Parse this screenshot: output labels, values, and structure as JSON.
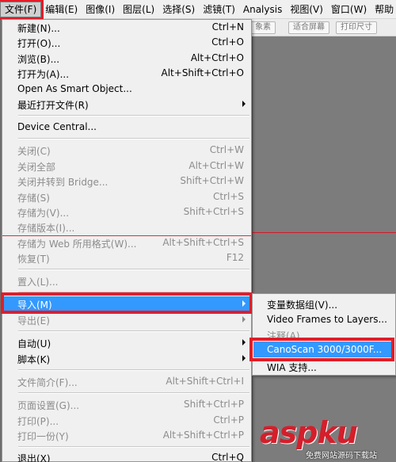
{
  "menubar": {
    "items": [
      "文件(F)",
      "编辑(E)",
      "图像(I)",
      "图层(L)",
      "选择(S)",
      "滤镜(T)",
      "Analysis",
      "视图(V)",
      "窗口(W)",
      "帮助"
    ]
  },
  "toolbar": {
    "buttons": [
      "象素",
      "适合屏幕",
      "打印尺寸"
    ]
  },
  "file_menu": {
    "items": [
      {
        "label": "新建(N)...",
        "shortcut": "Ctrl+N"
      },
      {
        "label": "打开(O)...",
        "shortcut": "Ctrl+O"
      },
      {
        "label": "浏览(B)...",
        "shortcut": "Alt+Ctrl+O"
      },
      {
        "label": "打开为(A)...",
        "shortcut": "Alt+Shift+Ctrl+O"
      },
      {
        "label": "Open As Smart Object...",
        "shortcut": ""
      },
      {
        "label": "最近打开文件(R)",
        "shortcut": ""
      },
      {
        "label": "Device Central...",
        "shortcut": ""
      },
      {
        "label": "关闭(C)",
        "shortcut": "Ctrl+W"
      },
      {
        "label": "关闭全部",
        "shortcut": "Alt+Ctrl+W"
      },
      {
        "label": "关闭并转到 Bridge...",
        "shortcut": "Shift+Ctrl+W"
      },
      {
        "label": "存储(S)",
        "shortcut": "Ctrl+S"
      },
      {
        "label": "存储为(V)...",
        "shortcut": "Shift+Ctrl+S"
      },
      {
        "label": "存储版本(I)...",
        "shortcut": ""
      },
      {
        "label": "存储为 Web 所用格式(W)...",
        "shortcut": "Alt+Shift+Ctrl+S"
      },
      {
        "label": "恢复(T)",
        "shortcut": "F12"
      },
      {
        "label": "置入(L)...",
        "shortcut": ""
      },
      {
        "label": "导入(M)",
        "shortcut": ""
      },
      {
        "label": "导出(E)",
        "shortcut": ""
      },
      {
        "label": "自动(U)",
        "shortcut": ""
      },
      {
        "label": "脚本(K)",
        "shortcut": ""
      },
      {
        "label": "文件简介(F)...",
        "shortcut": "Alt+Shift+Ctrl+I"
      },
      {
        "label": "页面设置(G)...",
        "shortcut": "Shift+Ctrl+P"
      },
      {
        "label": "打印(P)...",
        "shortcut": "Ctrl+P"
      },
      {
        "label": "打印一份(Y)",
        "shortcut": "Alt+Shift+Ctrl+P"
      },
      {
        "label": "退出(X)",
        "shortcut": "Ctrl+Q"
      }
    ]
  },
  "import_submenu": {
    "items": [
      {
        "label": "变量数据组(V)..."
      },
      {
        "label": "Video Frames to Layers..."
      },
      {
        "label": "注释(A)..."
      },
      {
        "label": "CanoScan 3000/3000F..."
      },
      {
        "label": "WIA 支持..."
      }
    ]
  },
  "watermark": {
    "brand": "aspku",
    "sub": "免费网站源码下载站"
  },
  "colors": {
    "highlight": "#3399ff",
    "annotation_red": "#e11d2a",
    "menu_bg": "#f0f0f0"
  }
}
